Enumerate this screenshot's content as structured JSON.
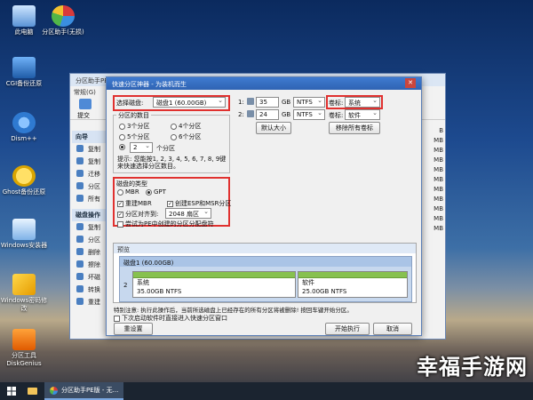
{
  "desktop": {
    "icons": [
      {
        "label": "此电脑"
      },
      {
        "label": "分区助手(无损)"
      },
      {
        "label": "CGI备份还原"
      },
      {
        "label": "Dism++"
      },
      {
        "label": "Ghost备份还原"
      },
      {
        "label": "Windows安装器"
      },
      {
        "label": "Windows密码修改"
      },
      {
        "label": "分区工具 DiskGenius"
      }
    ],
    "watermark": "幸福手游网"
  },
  "taskbar": {
    "app_label": "分区助手PE版 - 无..."
  },
  "main_window": {
    "title": "分区助手PE版",
    "menu": "常规(G)",
    "toolbar_submit": "提交",
    "sidebar": {
      "group1": "向导",
      "group1_items": [
        "复制",
        "复制",
        "迁移",
        "分区",
        "所有"
      ],
      "group2": "磁盘操作",
      "group2_items": [
        "复制",
        "分区",
        "删除",
        "擦除",
        "坏磁",
        "转换",
        "重建"
      ]
    },
    "right_values": [
      "B",
      "MB",
      "MB",
      "MB",
      "MB",
      "MB",
      "MB",
      "MB",
      "MB",
      "MB",
      "MB"
    ]
  },
  "dialog": {
    "title": "快速分区神器 - 为装机而生",
    "close": "✕",
    "select_disk_label": "选择磁盘:",
    "select_disk_value": "磁盘1 (60.00GB)",
    "partition_count_label": "分区的数目",
    "radios": [
      "3个分区",
      "4个分区",
      "5个分区",
      "6个分区"
    ],
    "custom_count": "2",
    "custom_count_suffix": "个分区",
    "hint": "提示: 您能按1, 2, 3, 4, 5, 6, 7, 8, 9键来快速选择分区数目。",
    "disk_type_label": "磁盘的类型",
    "mbr": "MBR",
    "gpt": "GPT",
    "rebuild_mbr": "重建MBR",
    "create_esp": "创建ESP和MSR分区",
    "align_label": "分区对齐到:",
    "align_value": "2048 扇区",
    "recovery_label": "尝试为PE中创建的分区分配盘符",
    "partitions": [
      {
        "index": "1:",
        "size": "35",
        "unit": "GB",
        "fs": "NTFS",
        "label_caption": "卷标:",
        "label_value": "系统"
      },
      {
        "index": "2:",
        "size": "24",
        "unit": "GB",
        "fs": "NTFS",
        "label_caption": "卷标:",
        "label_value": "软件"
      }
    ],
    "default_size_btn": "默认大小",
    "remove_labels_btn": "移除所有卷标",
    "preview_label": "预览",
    "disk_name": "磁盘1 (60.00GB)",
    "disk_parts": [
      {
        "name": "系统",
        "detail": "35.00GB NTFS"
      },
      {
        "name": "软件",
        "detail": "25.00GB NTFS"
      }
    ],
    "disk_index": "2",
    "warning": "特别注意: 执行此操作后，当前所选磁盘上已经存在的所有分区将被删除! 按回车键开始分区。",
    "auto_start": "下次启动软件时直接进入快速分区窗口",
    "reset_btn": "重设置",
    "start_btn": "开始执行",
    "cancel_btn": "取消"
  }
}
